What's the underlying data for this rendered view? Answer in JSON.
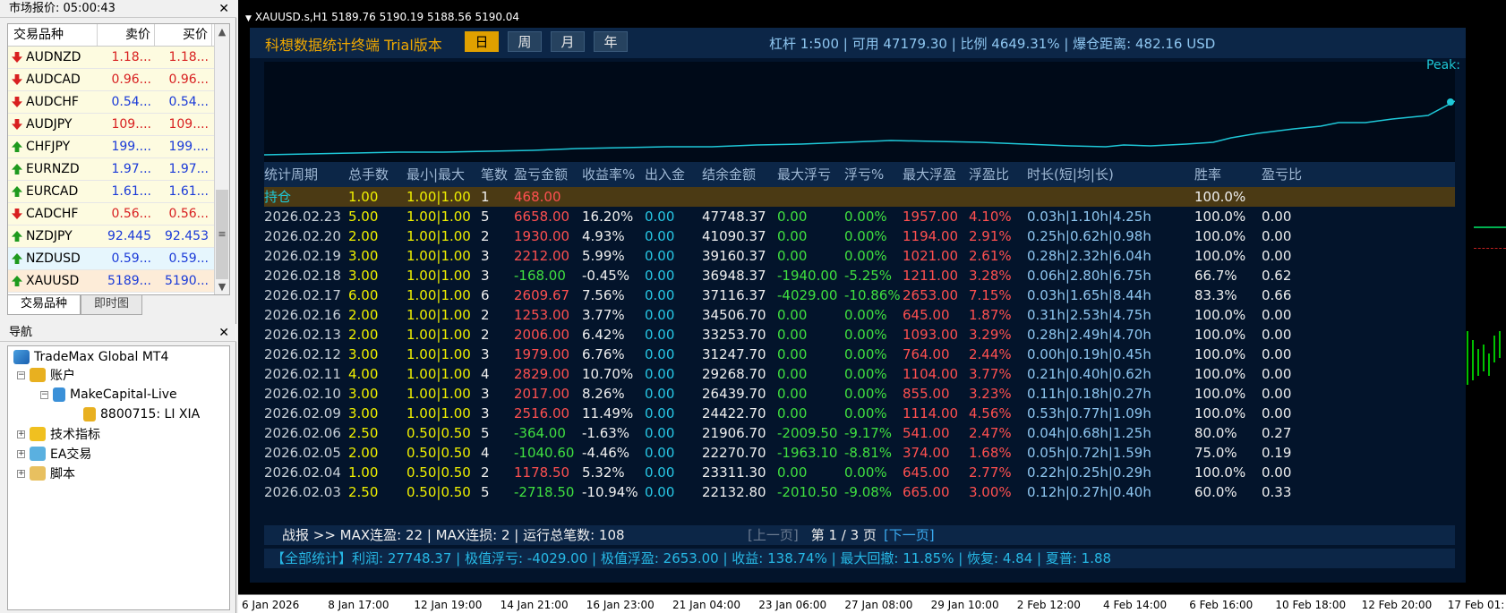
{
  "market_watch": {
    "title": "市场报价: 05:00:43",
    "columns": [
      "交易品种",
      "卖价",
      "买价"
    ],
    "rows": [
      {
        "symbol": "AUDNZD",
        "bid": "1.18...",
        "ask": "1.18...",
        "dir": "down",
        "color": "#d82020",
        "bg": "#fdfbe0"
      },
      {
        "symbol": "AUDCAD",
        "bid": "0.96...",
        "ask": "0.96...",
        "dir": "down",
        "color": "#d82020",
        "bg": "#fdfbe0"
      },
      {
        "symbol": "AUDCHF",
        "bid": "0.54...",
        "ask": "0.54...",
        "dir": "down",
        "color": "#1a3ad8",
        "bg": "#fdfbe0"
      },
      {
        "symbol": "AUDJPY",
        "bid": "109....",
        "ask": "109....",
        "dir": "down",
        "color": "#d82020",
        "bg": "#fdfbe0"
      },
      {
        "symbol": "CHFJPY",
        "bid": "199....",
        "ask": "199....",
        "dir": "up",
        "color": "#1a3ad8",
        "bg": "#fdfbe0"
      },
      {
        "symbol": "EURNZD",
        "bid": "1.97...",
        "ask": "1.97...",
        "dir": "up",
        "color": "#1a3ad8",
        "bg": "#fdfbe0"
      },
      {
        "symbol": "EURCAD",
        "bid": "1.61...",
        "ask": "1.61...",
        "dir": "up",
        "color": "#1a3ad8",
        "bg": "#fdfbe0"
      },
      {
        "symbol": "CADCHF",
        "bid": "0.56...",
        "ask": "0.56...",
        "dir": "down",
        "color": "#d82020",
        "bg": "#fdfbe0"
      },
      {
        "symbol": "NZDJPY",
        "bid": "92.445",
        "ask": "92.453",
        "dir": "up",
        "color": "#1a3ad8",
        "bg": "#fdfbe0"
      },
      {
        "symbol": "NZDUSD",
        "bid": "0.59...",
        "ask": "0.59...",
        "dir": "up",
        "color": "#1a3ad8",
        "bg": "#e6f6fd"
      },
      {
        "symbol": "XAUUSD",
        "bid": "5189...",
        "ask": "5190...",
        "dir": "up",
        "color": "#1a3ad8",
        "bg": "#fdecd8"
      }
    ],
    "tabs": [
      "交易品种",
      "即时图"
    ]
  },
  "navigator": {
    "title": "导航",
    "root": "TradeMax Global MT4",
    "accounts": "账户",
    "server": "MakeCapital-Live",
    "account": "8800715: LI XIA",
    "indicators": "技术指标",
    "ea": "EA交易",
    "scripts": "脚本"
  },
  "chart": {
    "header": "XAUUSD.s,H1  5189.76 5190.19 5188.56 5190.04",
    "time_labels": [
      "6 Jan 2026",
      "8 Jan 17:00",
      "12 Jan 19:00",
      "14 Jan 21:00",
      "16 Jan 23:00",
      "21 Jan 04:00",
      "23 Jan 06:00",
      "27 Jan 08:00",
      "29 Jan 10:00",
      "2 Feb 12:00",
      "4 Feb 14:00",
      "6 Feb 16:00",
      "10 Feb 18:00",
      "12 Feb 20:00",
      "17 Feb 01:"
    ]
  },
  "dashboard": {
    "brand": "科想数据统计终端 Trial版本",
    "periods": [
      "日",
      "周",
      "月",
      "年"
    ],
    "active_period": "日",
    "account_info": "杠杆 1:500 | 可用 47179.30 | 比例 4649.31% | 爆仓距离: 482.16 USD",
    "peak_label": "Peak",
    "columns": [
      "统计周期",
      "总手数",
      "最小|最大",
      "笔数",
      "盈亏金额",
      "收益率%",
      "出入金",
      "结余金额",
      "最大浮亏",
      "浮亏%",
      "最大浮盈",
      "浮盈比",
      "时长(短|均|长)",
      "胜率",
      "盈亏比"
    ],
    "holding": {
      "period": "持仓",
      "lots": "1.00",
      "minmax": "1.00|1.00",
      "count": "1",
      "pl": "468.00",
      "winrate": "100.0%"
    },
    "summary_line": "战报 >> MAX连盈: 22 | MAX连损: 2 | 运行总笔数: 108",
    "prev": "[上一页]",
    "page": "第 1 / 3 页",
    "next": "[下一页]",
    "all_stats": "【全部统计】利润: 27748.37 | 极值浮亏: -4029.00 | 极值浮盈: 2653.00 | 收益: 138.74% | 最大回撤: 11.85% | 恢复: 4.84 | 夏普: 1.88",
    "colors": {
      "accent": "#f0a800",
      "panel": "#03142b",
      "header": "#0c2647",
      "equity_line": "#1ec8d8"
    }
  },
  "chart_data": {
    "type": "table",
    "rows": [
      {
        "period": "2026.02.23",
        "lots": "5.00",
        "minmax": "1.00|1.00",
        "count": "5",
        "pl": "6658.00",
        "ret": "16.20%",
        "flow": "0.00",
        "balance": "47748.37",
        "maxdd": "0.00",
        "ddp": "0.00%",
        "maxfp": "1957.00",
        "fpr": "4.10%",
        "dur": "0.03h|1.10h|4.25h",
        "win": "100.0%",
        "pf": "0.00"
      },
      {
        "period": "2026.02.20",
        "lots": "2.00",
        "minmax": "1.00|1.00",
        "count": "2",
        "pl": "1930.00",
        "ret": "4.93%",
        "flow": "0.00",
        "balance": "41090.37",
        "maxdd": "0.00",
        "ddp": "0.00%",
        "maxfp": "1194.00",
        "fpr": "2.91%",
        "dur": "0.25h|0.62h|0.98h",
        "win": "100.0%",
        "pf": "0.00"
      },
      {
        "period": "2026.02.19",
        "lots": "3.00",
        "minmax": "1.00|1.00",
        "count": "3",
        "pl": "2212.00",
        "ret": "5.99%",
        "flow": "0.00",
        "balance": "39160.37",
        "maxdd": "0.00",
        "ddp": "0.00%",
        "maxfp": "1021.00",
        "fpr": "2.61%",
        "dur": "0.28h|2.32h|6.04h",
        "win": "100.0%",
        "pf": "0.00"
      },
      {
        "period": "2026.02.18",
        "lots": "3.00",
        "minmax": "1.00|1.00",
        "count": "3",
        "pl": "-168.00",
        "ret": "-0.45%",
        "flow": "0.00",
        "balance": "36948.37",
        "maxdd": "-1940.00",
        "ddp": "-5.25%",
        "maxfp": "1211.00",
        "fpr": "3.28%",
        "dur": "0.06h|2.80h|6.75h",
        "win": "66.7%",
        "pf": "0.62"
      },
      {
        "period": "2026.02.17",
        "lots": "6.00",
        "minmax": "1.00|1.00",
        "count": "6",
        "pl": "2609.67",
        "ret": "7.56%",
        "flow": "0.00",
        "balance": "37116.37",
        "maxdd": "-4029.00",
        "ddp": "-10.86%",
        "maxfp": "2653.00",
        "fpr": "7.15%",
        "dur": "0.03h|1.65h|8.44h",
        "win": "83.3%",
        "pf": "0.66"
      },
      {
        "period": "2026.02.16",
        "lots": "2.00",
        "minmax": "1.00|1.00",
        "count": "2",
        "pl": "1253.00",
        "ret": "3.77%",
        "flow": "0.00",
        "balance": "34506.70",
        "maxdd": "0.00",
        "ddp": "0.00%",
        "maxfp": "645.00",
        "fpr": "1.87%",
        "dur": "0.31h|2.53h|4.75h",
        "win": "100.0%",
        "pf": "0.00"
      },
      {
        "period": "2026.02.13",
        "lots": "2.00",
        "minmax": "1.00|1.00",
        "count": "2",
        "pl": "2006.00",
        "ret": "6.42%",
        "flow": "0.00",
        "balance": "33253.70",
        "maxdd": "0.00",
        "ddp": "0.00%",
        "maxfp": "1093.00",
        "fpr": "3.29%",
        "dur": "0.28h|2.49h|4.70h",
        "win": "100.0%",
        "pf": "0.00"
      },
      {
        "period": "2026.02.12",
        "lots": "3.00",
        "minmax": "1.00|1.00",
        "count": "3",
        "pl": "1979.00",
        "ret": "6.76%",
        "flow": "0.00",
        "balance": "31247.70",
        "maxdd": "0.00",
        "ddp": "0.00%",
        "maxfp": "764.00",
        "fpr": "2.44%",
        "dur": "0.00h|0.19h|0.45h",
        "win": "100.0%",
        "pf": "0.00"
      },
      {
        "period": "2026.02.11",
        "lots": "4.00",
        "minmax": "1.00|1.00",
        "count": "4",
        "pl": "2829.00",
        "ret": "10.70%",
        "flow": "0.00",
        "balance": "29268.70",
        "maxdd": "0.00",
        "ddp": "0.00%",
        "maxfp": "1104.00",
        "fpr": "3.77%",
        "dur": "0.21h|0.40h|0.62h",
        "win": "100.0%",
        "pf": "0.00"
      },
      {
        "period": "2026.02.10",
        "lots": "3.00",
        "minmax": "1.00|1.00",
        "count": "3",
        "pl": "2017.00",
        "ret": "8.26%",
        "flow": "0.00",
        "balance": "26439.70",
        "maxdd": "0.00",
        "ddp": "0.00%",
        "maxfp": "855.00",
        "fpr": "3.23%",
        "dur": "0.11h|0.18h|0.27h",
        "win": "100.0%",
        "pf": "0.00"
      },
      {
        "period": "2026.02.09",
        "lots": "3.00",
        "minmax": "1.00|1.00",
        "count": "3",
        "pl": "2516.00",
        "ret": "11.49%",
        "flow": "0.00",
        "balance": "24422.70",
        "maxdd": "0.00",
        "ddp": "0.00%",
        "maxfp": "1114.00",
        "fpr": "4.56%",
        "dur": "0.53h|0.77h|1.09h",
        "win": "100.0%",
        "pf": "0.00"
      },
      {
        "period": "2026.02.06",
        "lots": "2.50",
        "minmax": "0.50|0.50",
        "count": "5",
        "pl": "-364.00",
        "ret": "-1.63%",
        "flow": "0.00",
        "balance": "21906.70",
        "maxdd": "-2009.50",
        "ddp": "-9.17%",
        "maxfp": "541.00",
        "fpr": "2.47%",
        "dur": "0.04h|0.68h|1.25h",
        "win": "80.0%",
        "pf": "0.27"
      },
      {
        "period": "2026.02.05",
        "lots": "2.00",
        "minmax": "0.50|0.50",
        "count": "4",
        "pl": "-1040.60",
        "ret": "-4.46%",
        "flow": "0.00",
        "balance": "22270.70",
        "maxdd": "-1963.10",
        "ddp": "-8.81%",
        "maxfp": "374.00",
        "fpr": "1.68%",
        "dur": "0.05h|0.72h|1.59h",
        "win": "75.0%",
        "pf": "0.19"
      },
      {
        "period": "2026.02.04",
        "lots": "1.00",
        "minmax": "0.50|0.50",
        "count": "2",
        "pl": "1178.50",
        "ret": "5.32%",
        "flow": "0.00",
        "balance": "23311.30",
        "maxdd": "0.00",
        "ddp": "0.00%",
        "maxfp": "645.00",
        "fpr": "2.77%",
        "dur": "0.22h|0.25h|0.29h",
        "win": "100.0%",
        "pf": "0.00"
      },
      {
        "period": "2026.02.03",
        "lots": "2.50",
        "minmax": "0.50|0.50",
        "count": "5",
        "pl": "-2718.50",
        "ret": "-10.94%",
        "flow": "0.00",
        "balance": "22132.80",
        "maxdd": "-2010.50",
        "ddp": "-9.08%",
        "maxfp": "665.00",
        "fpr": "3.00%",
        "dur": "0.12h|0.27h|0.40h",
        "win": "60.0%",
        "pf": "0.33"
      }
    ]
  }
}
